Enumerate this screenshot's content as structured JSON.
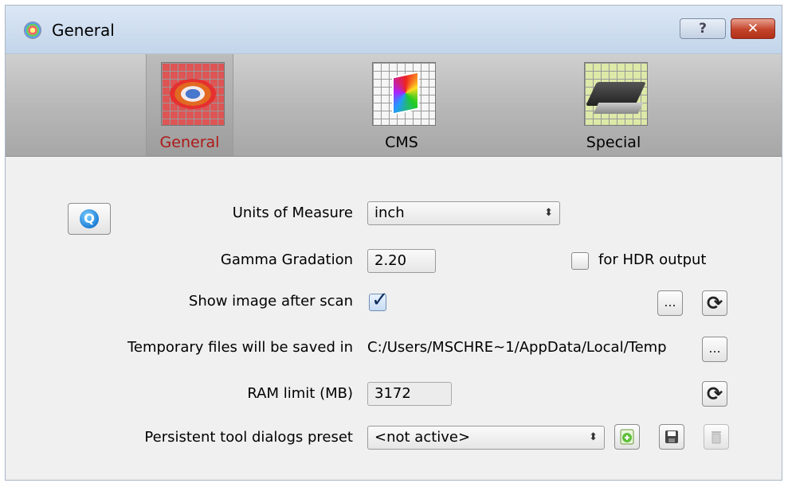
{
  "window": {
    "title": "General",
    "help_label": "?",
    "close_label": "✕"
  },
  "tabs": [
    {
      "label": "General",
      "icon": "color-target-icon",
      "active": true
    },
    {
      "label": "CMS",
      "icon": "color-profile-icon",
      "active": false
    },
    {
      "label": "Special",
      "icon": "scanner-icon",
      "active": false
    }
  ],
  "form": {
    "units": {
      "label": "Units of Measure",
      "value": "inch"
    },
    "gamma": {
      "label": "Gamma Gradation",
      "value": "2.20",
      "hdr_label": "for HDR output",
      "hdr_checked": false
    },
    "show_image": {
      "label": "Show image after scan",
      "checked": true
    },
    "temp_files": {
      "label": "Temporary files will be saved in",
      "path": "C:/Users/MSCHRE~1/AppData/Local/Temp"
    },
    "ram": {
      "label": "RAM limit (MB)",
      "value": "3172"
    },
    "preset": {
      "label": "Persistent tool dialogs preset",
      "value": "<not active>"
    }
  },
  "glyphs": {
    "browse": "...",
    "refresh": "⟳",
    "combo_arrow": "⬍",
    "check": "✓",
    "info": "Q"
  },
  "colors": {
    "active_tab_text": "#b01818",
    "close_button": "#c3442a"
  }
}
